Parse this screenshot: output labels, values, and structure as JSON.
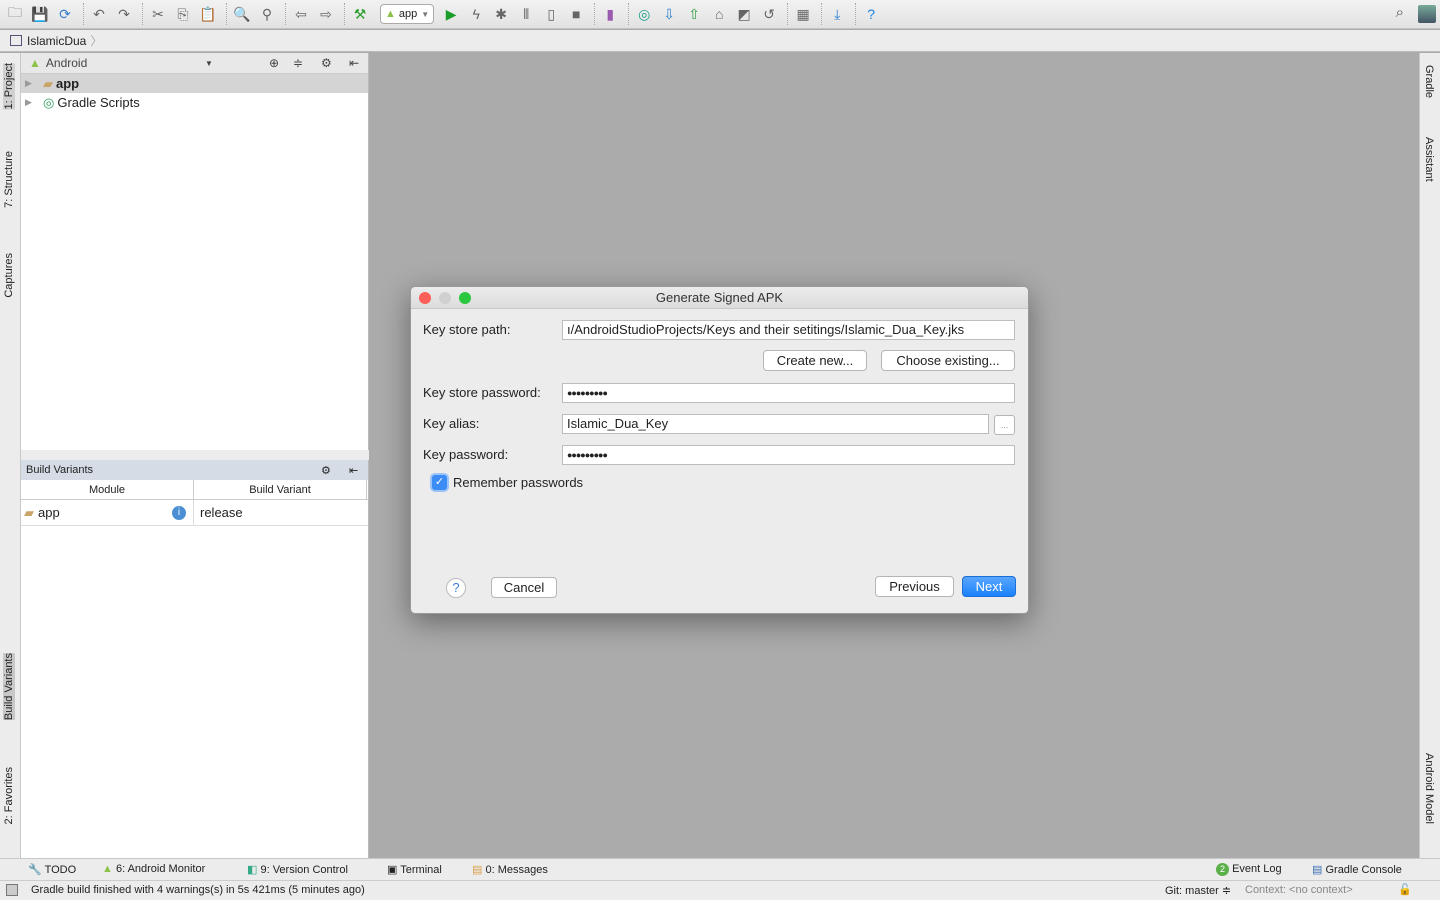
{
  "toolbar": {
    "icons": [
      "open-folder-icon",
      "save-icon",
      "sync-icon",
      "|",
      "undo-icon",
      "redo-icon",
      "|",
      "cut-icon",
      "copy-icon",
      "paste-icon",
      "|",
      "find-icon",
      "replace-icon",
      "|",
      "back-icon",
      "forward-icon",
      "|",
      "make-project-icon"
    ],
    "run_config": "app",
    "icons2": [
      "run-icon",
      "apply-changes-icon",
      "debug-icon",
      "profile-icon",
      "attach-debugger-icon",
      "stop-icon",
      "|",
      "avd-manager-icon",
      "|",
      "sync-gradle-icon",
      "vcs-update-icon",
      "vcs-commit-icon",
      "vcs-history-icon",
      "vcs-compare-icon",
      "revert-icon",
      "|",
      "project-structure-icon",
      "|",
      "sdk-manager-icon",
      "|",
      "help-icon"
    ]
  },
  "breadcrumb": "IslamicDua",
  "left_stripe": [
    "1: Project",
    "7: Structure",
    "Captures",
    "Build Variants",
    "2: Favorites"
  ],
  "right_stripe": [
    "Gradle",
    "Assistant",
    "Android Model"
  ],
  "project": {
    "view": "Android",
    "items": [
      "app",
      "Gradle Scripts"
    ]
  },
  "build_variants": {
    "title": "Build Variants",
    "columns": [
      "Module",
      "Build Variant"
    ],
    "rows": [
      {
        "module": "app",
        "variant": "release"
      }
    ]
  },
  "dialog": {
    "title": "Generate Signed APK",
    "key_store_path_label": "Key store path:",
    "key_store_path": "ı/AndroidStudioProjects/Keys and their setitings/Islamic_Dua_Key.jks",
    "create_new": "Create new...",
    "choose_existing": "Choose existing...",
    "key_store_password_label": "Key store password:",
    "key_store_password": "●●●●●●●●●",
    "key_alias_label": "Key alias:",
    "key_alias": "Islamic_Dua_Key",
    "browse": "...",
    "key_password_label": "Key password:",
    "key_password": "●●●●●●●●●",
    "remember_label": "Remember passwords",
    "remember_checked": true,
    "help": "?",
    "cancel": "Cancel",
    "previous": "Previous",
    "next": "Next",
    "accent": "#1a82fb"
  },
  "bottom_tools": {
    "left": [
      "TODO",
      "6: Android Monitor",
      "9: Version Control",
      "Terminal",
      "0: Messages"
    ],
    "event_log_count": "2",
    "event_log": "Event Log",
    "gradle_console": "Gradle Console"
  },
  "status": {
    "message": "Gradle build finished with 4 warnings(s) in 5s 421ms (5 minutes ago)",
    "git": "Git: master ≑",
    "context": "Context: <no context>"
  }
}
